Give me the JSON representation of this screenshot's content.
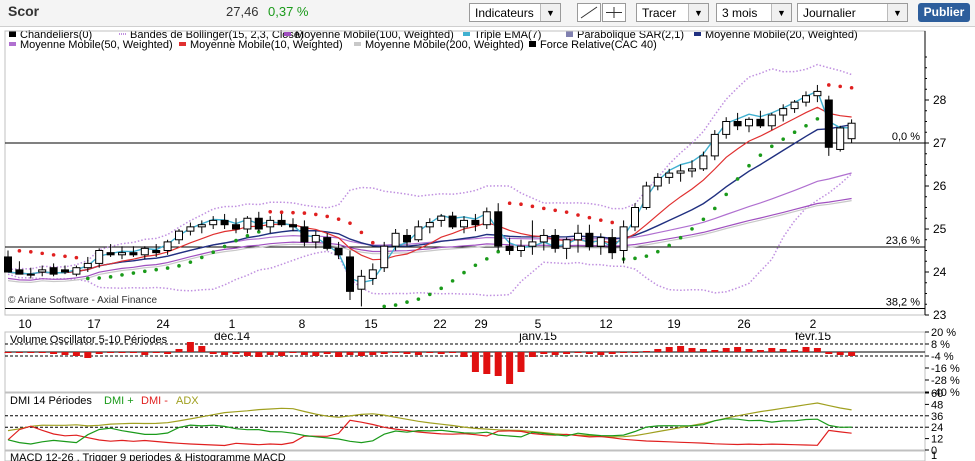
{
  "header": {
    "ticker": "Scor",
    "price": "27,46",
    "change": "0,37 %",
    "indicators_label": "Indicateurs",
    "tracer_label": "Tracer",
    "period_value": "3 mois",
    "interval_value": "Journalier",
    "publish_label": "Publier"
  },
  "legend": [
    {
      "label": "Chandeliers(0)",
      "color": "#000000",
      "style": "box"
    },
    {
      "label": "Bandes de Bollinger(15, 2,3, Close)",
      "color": "#c090e0",
      "style": "dots"
    },
    {
      "label": "Moyenne Mobile(100, Weighted)",
      "color": "#a050c0",
      "style": "bar"
    },
    {
      "label": "Triple EMA(7)",
      "color": "#40b0d0",
      "style": "bar"
    },
    {
      "label": "Parabolique SAR(2,1)",
      "color": "#8080b0",
      "style": "box"
    },
    {
      "label": "Moyenne Mobile(20, Weighted)",
      "color": "#203080",
      "style": "bar"
    },
    {
      "label": "Moyenne Mobile(50, Weighted)",
      "color": "#b070d0",
      "style": "bar"
    },
    {
      "label": "Moyenne Mobile(10, Weighted)",
      "color": "#e03030",
      "style": "bar"
    },
    {
      "label": "Moyenne Mobile(200, Weighted)",
      "color": "#c8c8c8",
      "style": "bar"
    },
    {
      "label": "Force Relative(CAC 40)",
      "color": "#000000",
      "style": "box"
    }
  ],
  "watermark": "Ariane Software - Axial Finance",
  "chart_data": [
    {
      "type": "candlestick",
      "panel": "price",
      "ylim": [
        23,
        29
      ],
      "yticks": [
        "23",
        "24",
        "25",
        "26",
        "27",
        "28"
      ],
      "fib_levels": [
        {
          "label": "0,0 %",
          "value": 27.0
        },
        {
          "label": "23,6 %",
          "value": 24.58
        },
        {
          "label": "38,2 %",
          "value": 23.15
        }
      ],
      "x_tick_labels": [
        "10",
        "17",
        "24",
        "1",
        "8",
        "15",
        "22",
        "29",
        "5",
        "12",
        "19",
        "26",
        "2"
      ],
      "x_month_labels": [
        {
          "label": "déc.14",
          "at": "1"
        },
        {
          "label": "janv.15",
          "at": "5"
        },
        {
          "label": "févr.15",
          "at": "2"
        }
      ],
      "candles": [
        [
          24.35,
          24.5,
          24.1,
          24.0
        ],
        [
          24.05,
          24.25,
          23.95,
          23.95
        ],
        [
          23.95,
          24.1,
          23.85,
          23.95
        ],
        [
          24.0,
          24.15,
          23.9,
          24.05
        ],
        [
          24.1,
          24.2,
          23.9,
          23.95
        ],
        [
          24.05,
          24.15,
          23.95,
          24.0
        ],
        [
          23.95,
          24.15,
          23.9,
          24.1
        ],
        [
          24.1,
          24.35,
          24.0,
          24.2
        ],
        [
          24.2,
          24.55,
          24.1,
          24.5
        ],
        [
          24.45,
          24.65,
          24.35,
          24.4
        ],
        [
          24.4,
          24.6,
          24.3,
          24.45
        ],
        [
          24.45,
          24.6,
          24.35,
          24.4
        ],
        [
          24.4,
          24.6,
          24.3,
          24.55
        ],
        [
          24.5,
          24.65,
          24.35,
          24.45
        ],
        [
          24.5,
          24.75,
          24.4,
          24.7
        ],
        [
          24.75,
          25.0,
          24.65,
          24.95
        ],
        [
          24.95,
          25.15,
          24.85,
          25.05
        ],
        [
          25.05,
          25.2,
          24.9,
          25.1
        ],
        [
          25.1,
          25.3,
          25.0,
          25.2
        ],
        [
          25.2,
          25.35,
          25.0,
          25.1
        ],
        [
          25.1,
          25.25,
          24.9,
          25.0
        ],
        [
          25.0,
          25.3,
          24.9,
          25.25
        ],
        [
          25.25,
          25.4,
          24.95,
          25.0
        ],
        [
          25.05,
          25.3,
          24.9,
          25.2
        ],
        [
          25.2,
          25.35,
          25.05,
          25.1
        ],
        [
          25.1,
          25.25,
          24.95,
          25.05
        ],
        [
          25.05,
          25.2,
          24.6,
          24.7
        ],
        [
          24.7,
          24.95,
          24.55,
          24.85
        ],
        [
          24.8,
          24.9,
          24.5,
          24.55
        ],
        [
          24.55,
          24.7,
          24.3,
          24.4
        ],
        [
          24.35,
          24.5,
          23.35,
          23.55
        ],
        [
          23.6,
          24.05,
          23.2,
          23.9
        ],
        [
          23.85,
          24.2,
          23.7,
          24.05
        ],
        [
          24.1,
          24.7,
          24.0,
          24.6
        ],
        [
          24.6,
          25.0,
          24.5,
          24.9
        ],
        [
          24.85,
          25.0,
          24.6,
          24.7
        ],
        [
          24.75,
          25.2,
          24.7,
          25.05
        ],
        [
          25.05,
          25.25,
          24.9,
          25.15
        ],
        [
          25.2,
          25.35,
          25.05,
          25.3
        ],
        [
          25.3,
          25.4,
          25.0,
          25.05
        ],
        [
          25.05,
          25.3,
          24.9,
          25.2
        ],
        [
          25.2,
          25.35,
          24.95,
          25.1
        ],
        [
          25.1,
          25.5,
          25.0,
          25.4
        ],
        [
          25.4,
          25.6,
          24.5,
          24.6
        ],
        [
          24.6,
          24.8,
          24.4,
          24.5
        ],
        [
          24.5,
          24.75,
          24.35,
          24.6
        ],
        [
          24.6,
          25.2,
          24.4,
          24.7
        ],
        [
          24.7,
          25.0,
          24.5,
          24.85
        ],
        [
          24.85,
          25.0,
          24.45,
          24.55
        ],
        [
          24.55,
          24.8,
          24.3,
          24.75
        ],
        [
          24.75,
          25.1,
          24.45,
          24.9
        ],
        [
          24.9,
          25.1,
          24.5,
          24.6
        ],
        [
          24.6,
          24.9,
          24.4,
          24.8
        ],
        [
          24.8,
          25.0,
          24.3,
          24.45
        ],
        [
          24.5,
          25.2,
          24.2,
          25.05
        ],
        [
          25.05,
          25.6,
          24.95,
          25.5
        ],
        [
          25.5,
          26.1,
          25.45,
          26.0
        ],
        [
          26.0,
          26.3,
          25.9,
          26.2
        ],
        [
          26.2,
          26.4,
          26.05,
          26.3
        ],
        [
          26.3,
          26.5,
          26.1,
          26.35
        ],
        [
          26.35,
          26.6,
          26.2,
          26.4
        ],
        [
          26.4,
          26.8,
          26.35,
          26.7
        ],
        [
          26.7,
          27.3,
          26.6,
          27.2
        ],
        [
          27.2,
          27.6,
          27.1,
          27.5
        ],
        [
          27.5,
          27.7,
          27.3,
          27.4
        ],
        [
          27.4,
          27.6,
          27.25,
          27.55
        ],
        [
          27.55,
          27.75,
          27.35,
          27.4
        ],
        [
          27.4,
          27.7,
          27.3,
          27.65
        ],
        [
          27.65,
          27.9,
          27.5,
          27.8
        ],
        [
          27.8,
          28.0,
          27.7,
          27.95
        ],
        [
          27.95,
          28.2,
          27.85,
          28.1
        ],
        [
          28.1,
          28.35,
          27.95,
          28.2
        ],
        [
          28.0,
          28.1,
          26.7,
          26.9
        ],
        [
          26.85,
          27.4,
          26.8,
          27.35
        ],
        [
          27.1,
          27.55,
          27.0,
          27.46
        ]
      ]
    },
    {
      "type": "bar",
      "panel": "volume_oscillator",
      "title": "Volume Oscillator 5-10 Périodes",
      "ylim": [
        -40,
        20
      ],
      "yticks": [
        "20 %",
        "8 %",
        "-4 %",
        "-16 %",
        "-28 %",
        "-40 %"
      ],
      "values": [
        0,
        0,
        0,
        -1,
        -2,
        -3,
        -4,
        -6,
        -2,
        -1,
        0,
        -1,
        -3,
        -1,
        -2,
        3,
        10,
        6,
        -2,
        -3,
        -2,
        -4,
        -5,
        -3,
        -4,
        -1,
        -3,
        -4,
        -2,
        -5,
        -3,
        -4,
        -3,
        -2,
        -1,
        -2,
        -3,
        -1,
        -2,
        -1,
        -5,
        -20,
        -22,
        -24,
        -32,
        -20,
        -5,
        -2,
        -3,
        -2,
        -1,
        -2,
        -3,
        -2,
        -1,
        0,
        1,
        3,
        5,
        6,
        4,
        3,
        2,
        4,
        5,
        3,
        2,
        4,
        3,
        2,
        5,
        4,
        -2,
        -3,
        -4
      ]
    },
    {
      "type": "line",
      "panel": "dmi",
      "title": "DMI 14 Périodes",
      "ylim": [
        0,
        60
      ],
      "yticks": [
        "60",
        "48",
        "36",
        "24",
        "12",
        "0"
      ],
      "series": [
        {
          "name": "DMI +",
          "color": "#1a9a1a"
        },
        {
          "name": "DMI -",
          "color": "#e02020"
        },
        {
          "name": "ADX",
          "color": "#a0a020"
        }
      ]
    },
    {
      "type": "line",
      "panel": "macd",
      "title": "MACD 12-26 , Trigger 9 periodes & Histogramme MACD",
      "yticks": [
        "1"
      ]
    }
  ]
}
